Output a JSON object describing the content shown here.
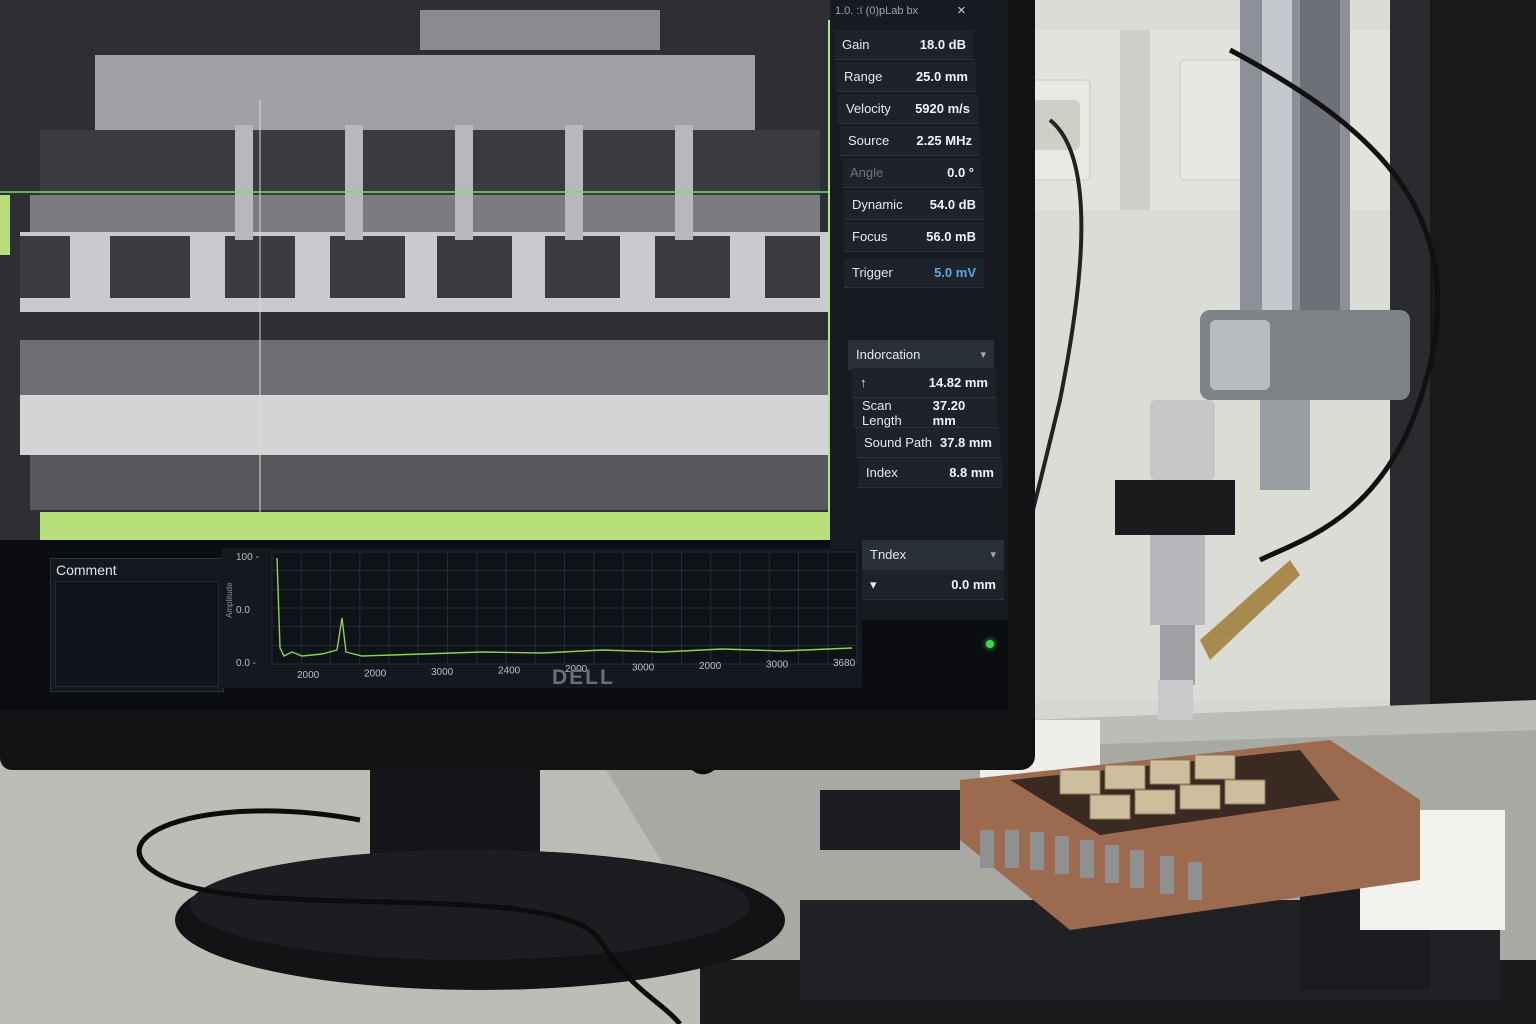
{
  "title_bar": {
    "text": "1.0.  :ï (0)pLab  bx",
    "close": "×"
  },
  "params": [
    {
      "label": "Gain",
      "value": "18.0 dB"
    },
    {
      "label": "Range",
      "value": "25.0 mm"
    },
    {
      "label": "Velocity",
      "value": "5920 m/s"
    },
    {
      "label": "Source",
      "value": "2.25 MHz"
    },
    {
      "label": "Angle",
      "value": "0.0 °"
    },
    {
      "label": "Dynamic",
      "value": "54.0 dB"
    },
    {
      "label": "Focus",
      "value": "56.0 mB"
    },
    {
      "label": "Trigger",
      "value": "5.0 mV"
    }
  ],
  "indication": {
    "dropdown": "Indorcation",
    "rows": [
      {
        "label": "↑",
        "value": "14.82 mm"
      },
      {
        "label": "Scan Length",
        "value": "37.20 mm"
      },
      {
        "label": "Sound Path",
        "value": "37.8 mm"
      },
      {
        "label": "Index",
        "value": "8.8 mm"
      }
    ]
  },
  "index_panel": {
    "dropdown": "Tndex",
    "value": "0.0 mm"
  },
  "comment": {
    "label": "Comment"
  },
  "waveform": {
    "y_ticks": [
      "100 -",
      "0.0",
      "0.0 -"
    ],
    "x_ticks": [
      "2000",
      "2000",
      "3000",
      "2400",
      "2000",
      "3000",
      "2000",
      "3000",
      "3680"
    ],
    "y_label": "Amplitude"
  },
  "monitor": {
    "brand": "DELL"
  },
  "colors": {
    "accent_green": "#b7e07a",
    "panel": "#1e232b",
    "trigger_blue": "#5aa9e6"
  }
}
